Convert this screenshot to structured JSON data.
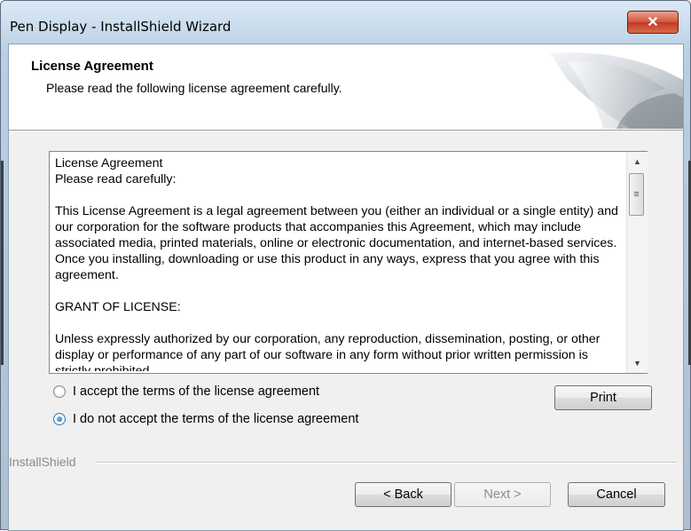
{
  "window": {
    "title": "Pen Display - InstallShield Wizard",
    "close_symbol": "✕"
  },
  "header": {
    "title": "License Agreement",
    "subtitle": "Please read the following license agreement carefully."
  },
  "license": {
    "lines": [
      "License Agreement",
      "Please read carefully:",
      "",
      "This License Agreement is a legal agreement between you (either an individual or a single entity) and our corporation for the software products that accompanies this Agreement, which may include associated media, printed materials, online or electronic documentation, and internet-based services. Once you installing, downloading or use this product in any ways, express that you agree with this agreement.",
      "",
      "GRANT OF LICENSE:",
      "",
      "Unless expressly authorized by our corporation, any reproduction, dissemination, posting, or other display or performance of any part of our software in any form without prior written permission is strictly prohibited."
    ],
    "scroll_up": "▲",
    "scroll_down": "▼",
    "thumb_grip": "≡"
  },
  "options": {
    "accept_label": "I accept the terms of the license agreement",
    "decline_label": "I do not accept the terms of the license agreement",
    "selected": "decline"
  },
  "buttons": {
    "print": "Print",
    "back": "< Back",
    "next": "Next >",
    "cancel": "Cancel"
  },
  "footer": {
    "brand": "InstallShield"
  }
}
